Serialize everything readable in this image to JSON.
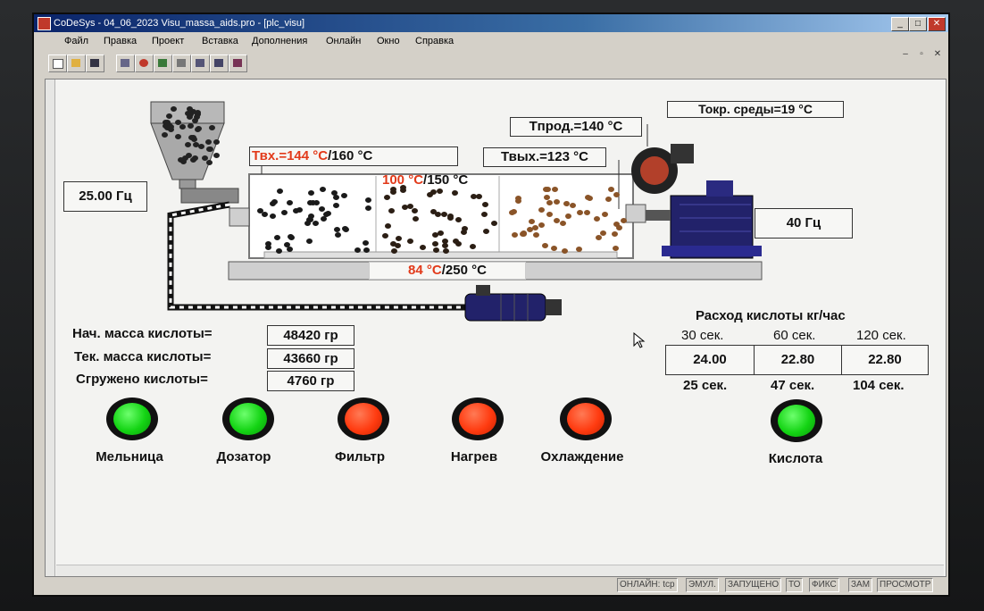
{
  "window": {
    "title": "CoDeSys - 04_06_2023 Visu_massa_aids.pro - [plc_visu]",
    "controls": [
      "_",
      "□",
      "✕"
    ],
    "mdi_controls": [
      "–",
      "▫",
      "✕"
    ]
  },
  "menu": [
    "Файл",
    "Правка",
    "Проект",
    "Вставка",
    "Дополнения",
    "Онлайн",
    "Окно",
    "Справка"
  ],
  "visu": {
    "t_ambient": "Токр. среды=19 °С",
    "t_product": "Тпрод.=140 °С",
    "t_in_value": "Твх.=144 °С",
    "t_in_set": "/160 °С",
    "t_out": "Твых.=123 °С",
    "zone_mid_value": "100 °С",
    "zone_mid_set": "/150 °С",
    "zone_bottom_value": "84 °С",
    "zone_bottom_set": "/250 °С",
    "left_freq": "25.00 Гц",
    "right_freq": "40 Гц",
    "mass": {
      "initial_label": "Нач. масса кислоты=",
      "initial_value": "48420 гр",
      "current_label": "Тек. масса кислоты=",
      "current_value": "43660 гр",
      "unloaded_label": "Сгружено кислоты=",
      "unloaded_value": "4760 гр"
    },
    "flow": {
      "title": "Расход кислоты кг/час",
      "intervals": [
        "30 сек.",
        "60 сек.",
        "120 сек."
      ],
      "values": [
        "24.00",
        "22.80",
        "22.80"
      ],
      "times": [
        "25 сек.",
        "47 сек.",
        "104 сек."
      ]
    },
    "indicators": [
      {
        "label": "Мельница",
        "state": "on",
        "color": "#14d414"
      },
      {
        "label": "Дозатор",
        "state": "on",
        "color": "#14d414"
      },
      {
        "label": "Фильтр",
        "state": "off",
        "color": "#ff3b10"
      },
      {
        "label": "Нагрев",
        "state": "off",
        "color": "#ff3b10"
      },
      {
        "label": "Охлаждение",
        "state": "off",
        "color": "#ff3b10"
      },
      {
        "label": "Кислота",
        "state": "on",
        "color": "#14d414"
      }
    ]
  },
  "status": [
    "ОНЛАЙН: tcp",
    "ЭМУЛ.",
    "ЗАПУЩЕНО",
    "ТО",
    "ФИКС",
    "ЗАМ",
    "ПРОСМОТР"
  ]
}
